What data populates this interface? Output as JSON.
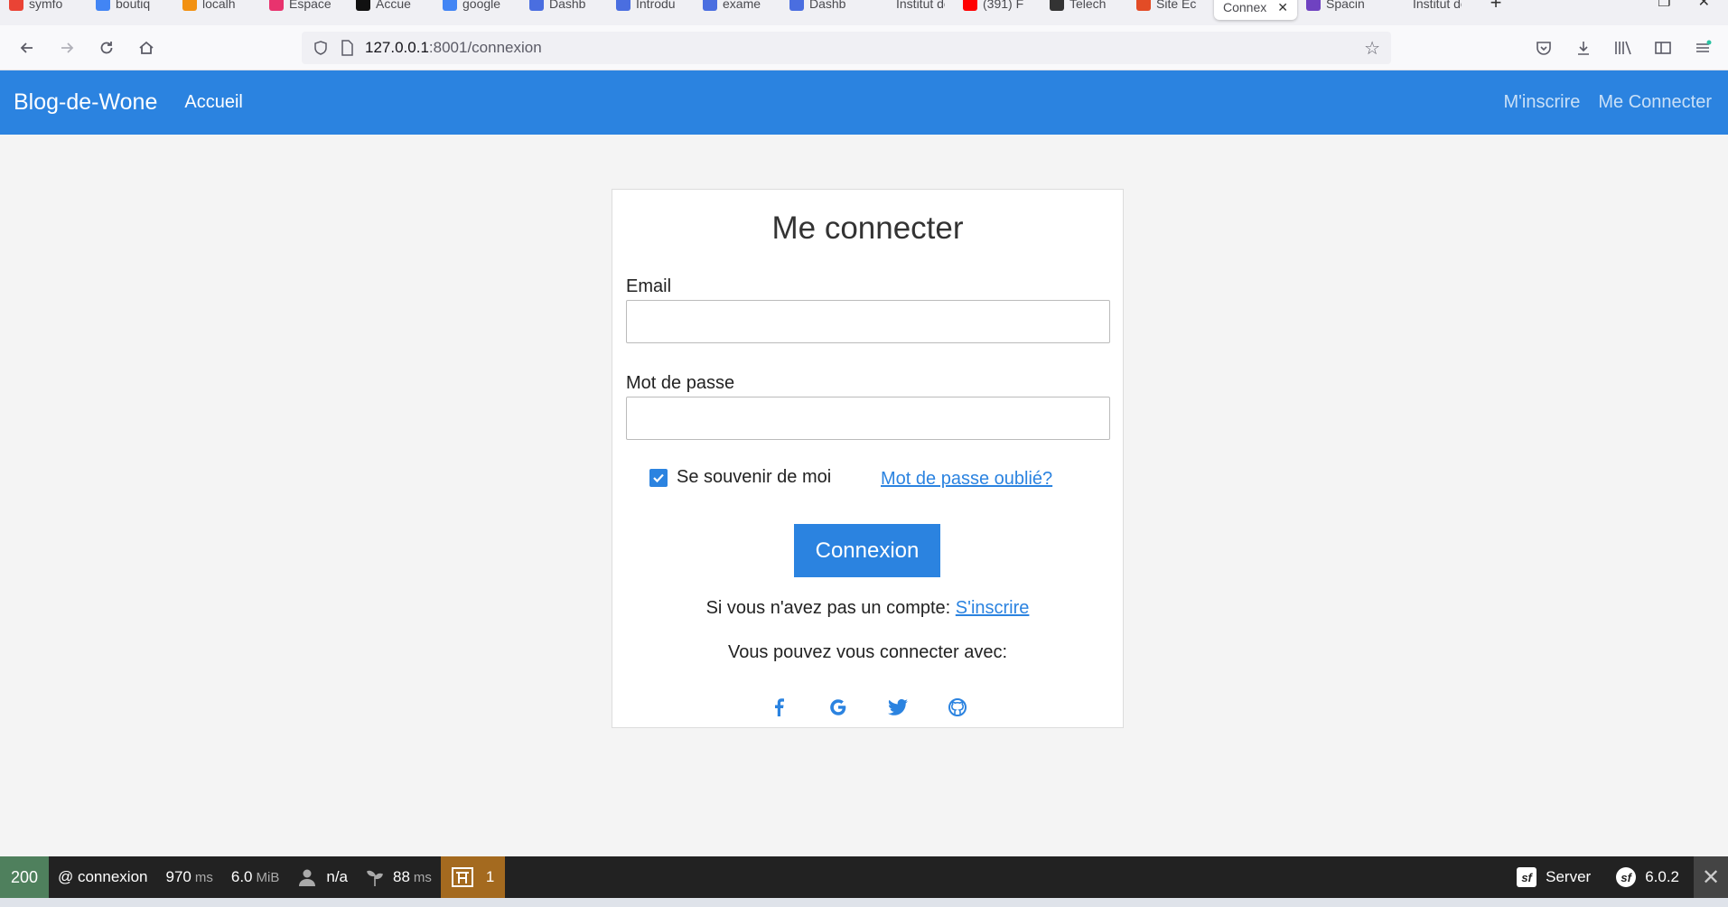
{
  "browser": {
    "tabs": [
      {
        "label": "symfo",
        "color": "#ea4335"
      },
      {
        "label": "boutiq",
        "color": "#4285f4"
      },
      {
        "label": "localh",
        "color": "#f29111"
      },
      {
        "label": "Espace",
        "color": "#e8336e"
      },
      {
        "label": "Accue",
        "color": "#111111"
      },
      {
        "label": "google",
        "color": "#4285f4"
      },
      {
        "label": "Dashb",
        "color": "#4a6ee0"
      },
      {
        "label": "Introdu",
        "color": "#4a6ee0"
      },
      {
        "label": "exame",
        "color": "#4a6ee0"
      },
      {
        "label": "Dashb",
        "color": "#4a6ee0"
      },
      {
        "label": "Institut de",
        "color": "#f0f0f4"
      },
      {
        "label": "(391) F",
        "color": "#ff0000"
      },
      {
        "label": "Telech",
        "color": "#333333"
      },
      {
        "label": "Site Ec",
        "color": "#e34c26"
      }
    ],
    "active_tab": {
      "label": "Connex",
      "close": "✕"
    },
    "tabs_after": [
      {
        "label": "Spacin",
        "color": "#6f42c1"
      },
      {
        "label": "Institut de",
        "color": "#f0f0f4"
      }
    ],
    "new_tab": "+",
    "url_host": "127.0.0.1",
    "url_path": ":8001/connexion"
  },
  "site": {
    "brand": "Blog-de-Wone",
    "nav_home": "Accueil",
    "nav_register": "M'inscrire",
    "nav_login": "Me Connecter"
  },
  "login": {
    "title": "Me connecter",
    "email_label": "Email",
    "email_value": "",
    "password_label": "Mot de passe",
    "password_value": "",
    "remember_label": "Se souvenir de moi",
    "remember_checked": true,
    "forgot_link": "Mot de passe oublié?",
    "submit": "Connexion",
    "no_account_text": "Si vous n'avez pas un compte:",
    "register_link": "S'inscrire",
    "social_text": "Vous pouvez vous connecter avec:",
    "socials": [
      "facebook-icon",
      "google-icon",
      "twitter-icon",
      "github-icon"
    ],
    "accent": "#2b83e0"
  },
  "sf_toolbar": {
    "status": "200",
    "route": "@ connexion",
    "time_value": "970",
    "time_unit": "ms",
    "memory_value": "6.0",
    "memory_unit": "MiB",
    "user": "n/a",
    "init_value": "88",
    "init_unit": "ms",
    "twig_count": "1",
    "server": "Server",
    "version": "6.0.2"
  }
}
